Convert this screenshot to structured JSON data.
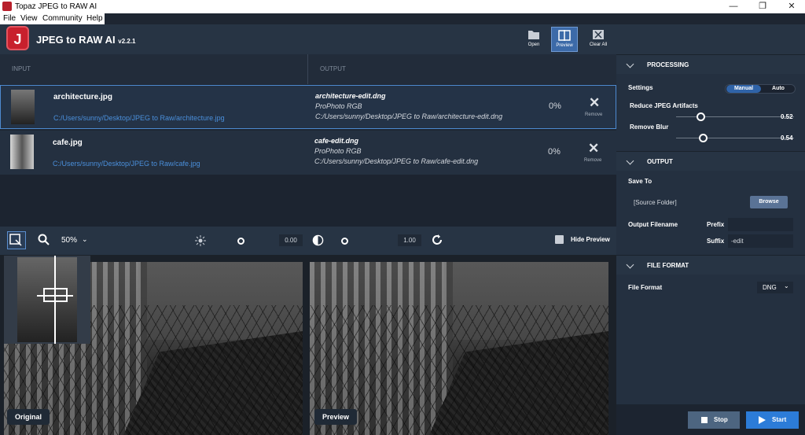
{
  "window": {
    "title": "Topaz JPEG to RAW AI",
    "minimize": "—",
    "maximize": "❐",
    "close": "✕"
  },
  "menu": [
    "File",
    "View",
    "Community",
    "Help"
  ],
  "app": {
    "name": "JPEG to RAW AI",
    "version": "v2.2.1",
    "logo_letter": "J"
  },
  "toolbar": {
    "open": "Open",
    "preview": "Preview",
    "clear_all": "Clear All"
  },
  "columns": {
    "input": "INPUT",
    "output": "OUTPUT"
  },
  "files": [
    {
      "name": "architecture.jpg",
      "path": "C:/Users/sunny/Desktop/JPEG to Raw/architecture.jpg",
      "out_name": "architecture-edit.dng",
      "out_profile": "ProPhoto RGB",
      "out_path": "C:/Users/sunny/Desktop/JPEG to Raw/architecture-edit.dng",
      "progress": "0%",
      "remove": "Remove"
    },
    {
      "name": "cafe.jpg",
      "path": "C:/Users/sunny/Desktop/JPEG to Raw/cafe.jpg",
      "out_name": "cafe-edit.dng",
      "out_profile": "ProPhoto RGB",
      "out_path": "C:/Users/sunny/Desktop/JPEG to Raw/cafe-edit.dng",
      "progress": "0%",
      "remove": "Remove"
    }
  ],
  "view": {
    "zoom": "50%",
    "exposure": "0.00",
    "contrast": "1.00",
    "hide_preview": "Hide Preview"
  },
  "labels": {
    "original": "Original",
    "preview": "Preview"
  },
  "processing": {
    "header": "PROCESSING",
    "settings": "Settings",
    "manual": "Manual",
    "auto": "Auto",
    "reduce_label": "Reduce JPEG Artifacts",
    "reduce_value": "0.52",
    "blur_label": "Remove Blur",
    "blur_value": "0.54"
  },
  "output": {
    "header": "OUTPUT",
    "save_to": "Save To",
    "folder": "[Source Folder]",
    "browse": "Browse",
    "output_filename": "Output Filename",
    "prefix_label": "Prefix",
    "prefix_value": "",
    "suffix_label": "Suffix",
    "suffix_value": "-edit"
  },
  "file_format": {
    "header": "FILE FORMAT",
    "label": "File Format",
    "value": "DNG"
  },
  "actions": {
    "stop": "Stop",
    "start": "Start"
  },
  "colors": {
    "accent": "#2c7cd8",
    "brand": "#c8202d",
    "link": "#4a8fdb",
    "panel": "#243040"
  }
}
